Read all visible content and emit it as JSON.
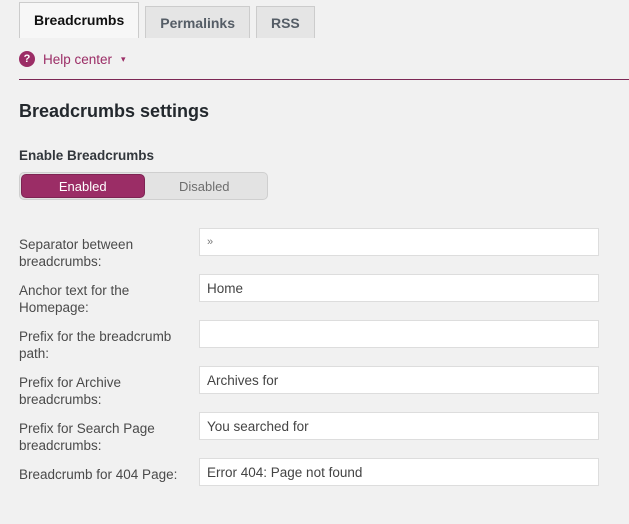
{
  "tabs": [
    {
      "label": "Breadcrumbs",
      "active": true
    },
    {
      "label": "Permalinks",
      "active": false
    },
    {
      "label": "RSS",
      "active": false
    }
  ],
  "help": {
    "icon": "question-mark-circle-icon",
    "label": "Help center",
    "caret": "▾"
  },
  "page": {
    "title": "Breadcrumbs settings"
  },
  "enable": {
    "label": "Enable Breadcrumbs",
    "enabled_label": "Enabled",
    "disabled_label": "Disabled",
    "selected": "Enabled"
  },
  "fields": [
    {
      "label": "Separator between breadcrumbs:",
      "value": "»"
    },
    {
      "label": "Anchor text for the Homepage:",
      "value": "Home"
    },
    {
      "label": "Prefix for the breadcrumb path:",
      "value": ""
    },
    {
      "label": "Prefix for Archive breadcrumbs:",
      "value": "Archives for"
    },
    {
      "label": "Prefix for Search Page breadcrumbs:",
      "value": "You searched for"
    },
    {
      "label": "Breadcrumb for 404 Page:",
      "value": "Error 404: Page not found"
    }
  ],
  "colors": {
    "accent": "#9b2d66",
    "divider": "#7c2855",
    "background": "#f1f1f1",
    "input_border": "#dddddd"
  }
}
